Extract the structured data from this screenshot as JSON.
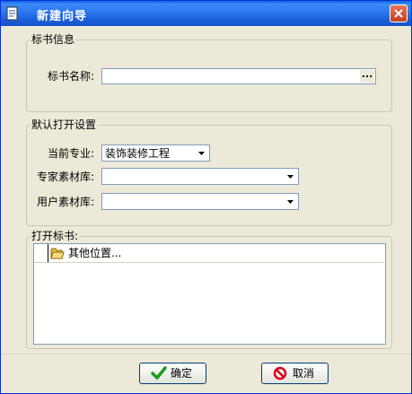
{
  "window": {
    "title": "新建向导"
  },
  "bid_info": {
    "legend": "标书信息",
    "name_label": "标书名称:",
    "name_value": "",
    "browse_label": "..."
  },
  "default_open": {
    "legend": "默认打开设置",
    "current_major_label": "当前专业:",
    "current_major_value": "装饰装修工程",
    "expert_library_label": "专家素材库:",
    "expert_library_value": "",
    "user_library_label": "用户素材库:",
    "user_library_value": ""
  },
  "open_bid": {
    "legend": "打开标书:",
    "items": [
      {
        "label": "其他位置..."
      }
    ]
  },
  "buttons": {
    "ok_label": "确定",
    "cancel_label": "取消"
  }
}
